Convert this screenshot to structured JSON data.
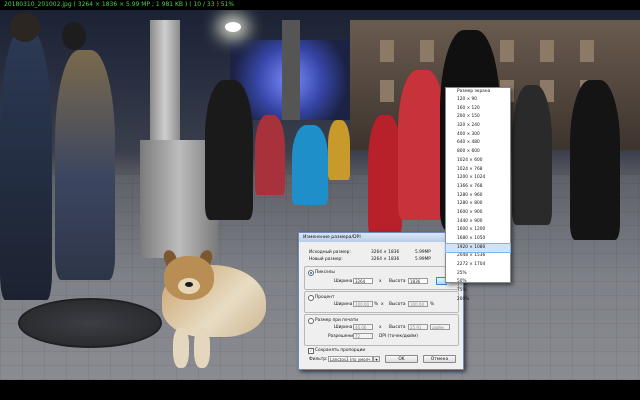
{
  "viewer": {
    "status_line": "20180310_201002.jpg  ( 3264 × 1836 × 5.99 MP ;  1 981 KB )  ( 10 / 33 )    51%"
  },
  "resize_dialog": {
    "title": "Изменение размера/DPI",
    "close_glyph": "×",
    "original_size_label": "Исходный размер:",
    "original_size_value": "3264 × 1836",
    "original_size_mp": "5.99MP",
    "new_size_label": "Новый размер:",
    "new_size_value": "3264 × 1836",
    "new_size_mp": "5.99MP",
    "pixels_label": "Пикселы",
    "pixels_width_label": "Ширина",
    "pixels_width_value": "3264",
    "pixels_x": "x",
    "pixels_height_label": "Высота",
    "pixels_height_value": "1836",
    "percent_label": "Процент",
    "percent_width_label": "Ширина",
    "percent_width_value": "100.00",
    "percent_sign_1": "%",
    "percent_x": "x",
    "percent_height_label": "Высота",
    "percent_height_value": "100.00",
    "percent_sign_2": "%",
    "print_label": "Размер при печати",
    "print_width_label": "Ширина",
    "print_width_value": "46.06",
    "print_x": "x",
    "print_height_label": "Высота",
    "print_height_value": "25.91",
    "print_unit": "дюйм",
    "resolution_label": "Разрешение",
    "resolution_value": "72",
    "resolution_unit": "DPI (точек/дюйм)",
    "keep_proportions_label": "Сохранять пропорции",
    "filter_label": "Фильтр:",
    "filter_value": "Lanczos3 (по умолч",
    "ok_label": "OK",
    "cancel_label": "Отмена"
  },
  "screen_size_menu": {
    "title": "Размер экрана",
    "items": [
      "120 × 90",
      "160 × 120",
      "200 × 150",
      "320 × 240",
      "400 × 300",
      "640 × 480",
      "800 × 600",
      "1024 × 600",
      "1024 × 768",
      "1200 × 1024",
      "1366 × 768",
      "1280 × 960",
      "1280 × 800",
      "1600 × 900",
      "1440 × 900",
      "1600 × 1200",
      "1680 × 1050",
      "1920 × 1080",
      "2048 × 1536",
      "2272 × 1704",
      "25%",
      "50%",
      "75%",
      "200%"
    ],
    "highlighted_index": 17
  },
  "colors": {
    "status_text": "#4fd24f",
    "menu_highlight": "#cfe3fb"
  }
}
